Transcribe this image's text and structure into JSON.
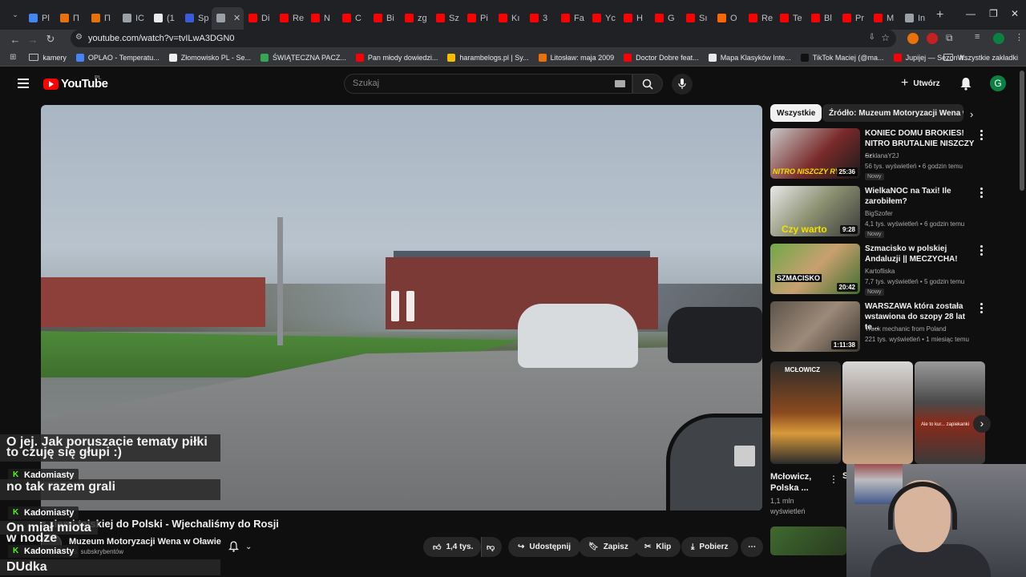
{
  "browser": {
    "tabs": [
      {
        "label": "Pl",
        "color": "#4285f4"
      },
      {
        "label": "П",
        "color": "#e8710a"
      },
      {
        "label": "П",
        "color": "#e8710a"
      },
      {
        "label": "IC",
        "color": "#9aa0a6"
      },
      {
        "label": "(1",
        "color": "#e8eaed"
      },
      {
        "label": "Sp",
        "color": "#3b5bdb"
      },
      {
        "label": "",
        "color": "#9aa0a6"
      },
      {
        "label": "Di",
        "color": "#ff0000"
      },
      {
        "label": "Re",
        "color": "#ff0000"
      },
      {
        "label": "N",
        "color": "#ff0000"
      },
      {
        "label": "C",
        "color": "#ff0000"
      },
      {
        "label": "Bi",
        "color": "#ff0000"
      },
      {
        "label": "zg",
        "color": "#ff0000"
      },
      {
        "label": "Sz",
        "color": "#ff0000"
      },
      {
        "label": "Pi",
        "color": "#ff0000"
      },
      {
        "label": "Kı",
        "color": "#ff0000"
      },
      {
        "label": "3",
        "color": "#ff0000"
      },
      {
        "label": "Fa",
        "color": "#ff0000"
      },
      {
        "label": "Yc",
        "color": "#ff0000"
      },
      {
        "label": "H",
        "color": "#ff0000"
      },
      {
        "label": "G",
        "color": "#ff0000"
      },
      {
        "label": "Sı",
        "color": "#ff0000"
      },
      {
        "label": "O",
        "color": "#ff6600"
      },
      {
        "label": "Re",
        "color": "#ff0000"
      },
      {
        "label": "Te",
        "color": "#ff0000"
      },
      {
        "label": "Bl",
        "color": "#ff0000"
      },
      {
        "label": "Pr",
        "color": "#ff0000"
      },
      {
        "label": "M",
        "color": "#ff0000"
      },
      {
        "label": "In",
        "color": "#9aa0a6"
      }
    ],
    "url": "youtube.com/watch?v=tvILwA3DGN0",
    "bookmarks": [
      {
        "label": "kamery",
        "type": "folder"
      },
      {
        "label": "OPLAO - Temperatu...",
        "color": "#4285f4"
      },
      {
        "label": "Złomowisko PL - Se...",
        "color": "#f1f1f1"
      },
      {
        "label": "ŚWIĄTECZNA PACZ...",
        "color": "#34a853"
      },
      {
        "label": "Pan młody dowiedzi...",
        "color": "#ff0000"
      },
      {
        "label": "harambelogs.pl | Sy...",
        "color": "#fbbc04"
      },
      {
        "label": "Litosław: maja 2009",
        "color": "#e8710a"
      },
      {
        "label": "Doctor Dobre feat...",
        "color": "#ff0000"
      },
      {
        "label": "Mapa Klasyków Inte...",
        "color": "#e8eaed"
      },
      {
        "label": "TikTok Maciej (@ma...",
        "color": "#111"
      },
      {
        "label": "Jupijej — Sezon ft....",
        "color": "#ff0000"
      }
    ],
    "all_bookmarks": "Wszystkie zakładki"
  },
  "header": {
    "logo_text": "YouTube",
    "region": "PL",
    "search_placeholder": "Szukaj",
    "create_label": "Utwórz",
    "avatar_letter": "G"
  },
  "video": {
    "title": "z ziemi tajskiej do Polski - Wjechaliśmy do Rosji",
    "channel": "Muzeum Motoryzacji Wena w Oławie",
    "subscribers": "tys. subskrybentów",
    "likes": "1,4 tys.",
    "share": "Udostępnij",
    "save": "Zapisz",
    "clip": "Klip",
    "download": "Pobierz"
  },
  "chat": {
    "messages": [
      {
        "text": "O jej. Jak poruszacie tematy piłki to czuję się głupi :)"
      },
      {
        "user": "Kadomiasty",
        "text": "no tak razem grali"
      },
      {
        "user": "Kadomiasty",
        "text": "On miał miota w nodze"
      },
      {
        "user": "Kadomiasty",
        "text": "DUdka"
      }
    ]
  },
  "sidebar": {
    "chips": [
      "Wszystkie",
      "Źródło: Muzeum Motoryzacji Wena w O"
    ],
    "recommendations": [
      {
        "title": "KONIEC DOMU BROKIES! NITRO BRUTALNIE NISZCZY ...",
        "channel": "SzklanaY2J",
        "stats": "56 tys. wyświetleń • 6 godzin temu",
        "badge": "Nowy",
        "duration": "25:36",
        "thumb_text": "NITRO NISZCZY RYB"
      },
      {
        "title": "WielkaNOC na Taxi! Ile zarobiłem?",
        "channel": "BigSzofer",
        "stats": "4,1 tys. wyświetleń • 6 godzin temu",
        "badge": "Nowy",
        "duration": "9:28",
        "thumb_text": "Czy warto"
      },
      {
        "title": "Szmacisko w polskiej Andaluzji || MECZYCHA!",
        "channel": "Kartofliska",
        "stats": "7,7 tys. wyświetleń • 5 godzin temu",
        "badge": "Nowy",
        "duration": "20:42",
        "thumb_text": "SZMACISKO"
      },
      {
        "title": "WARSZAWA która została wstawiona do szopy 28 lat te...",
        "channel": "Truck mechanic from Poland",
        "stats": "221 tys. wyświetleń • 1 miesiąc temu",
        "badge": "",
        "duration": "1:11:38",
        "thumb_text": ""
      }
    ],
    "shorts": [
      {
        "title": "Mcłowicz, Polska ...",
        "views": "1,1 mln wyświetleń",
        "thumb_text": "MCŁOWICZ"
      },
      {
        "title": "S...",
        "views": "",
        "thumb_text": ""
      },
      {
        "title": "",
        "views": "",
        "thumb_text": "Ale to kur... zapiekanki"
      }
    ]
  }
}
